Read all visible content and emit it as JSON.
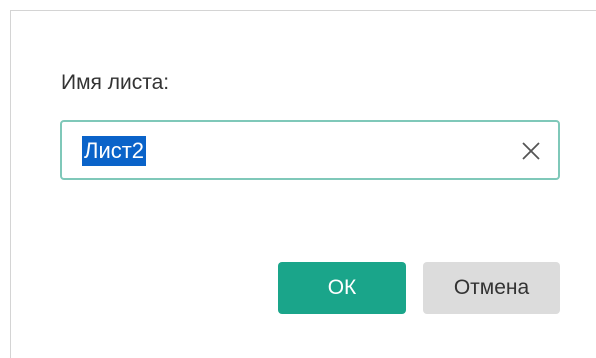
{
  "dialog": {
    "field_label": "Имя листа:",
    "input_value": "Лист2",
    "ok_label": "ОК",
    "cancel_label": "Отмена"
  },
  "icons": {
    "clear": "close-icon"
  },
  "colors": {
    "accent": "#1aa58a",
    "input_border": "#7fc8b9",
    "selection": "#0a63c9",
    "cancel_bg": "#dcdcdc"
  }
}
